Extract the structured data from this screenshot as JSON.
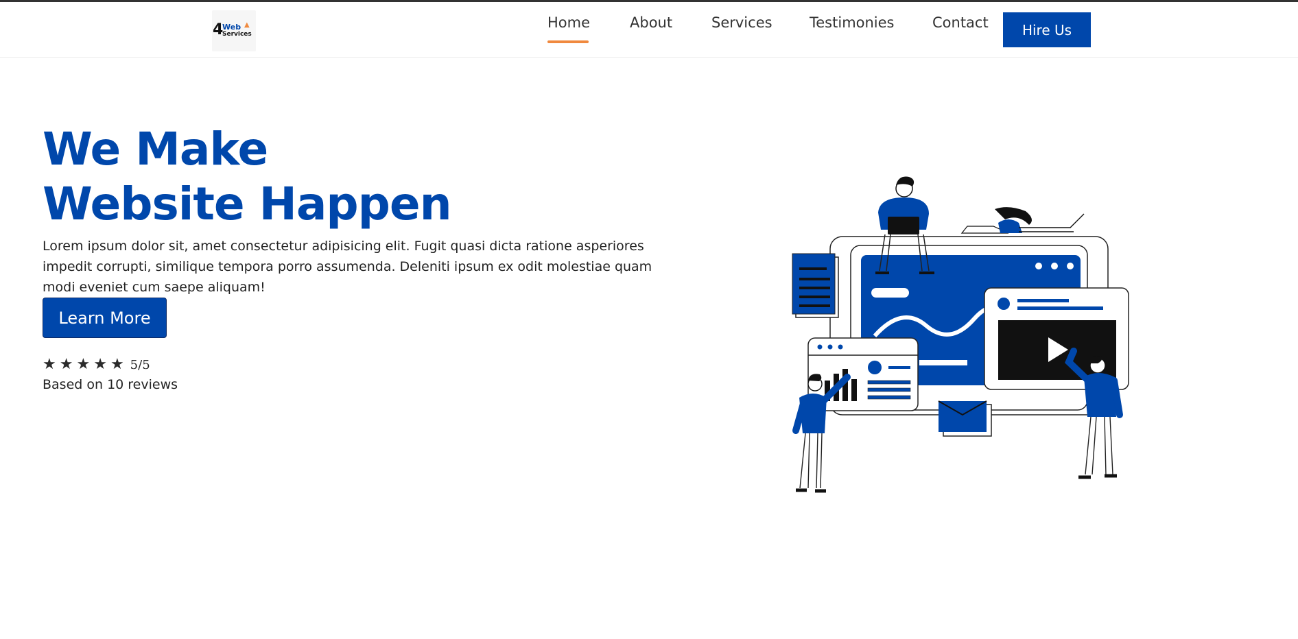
{
  "brand": {
    "logo_number": "4",
    "logo_word_top": "Web",
    "logo_word_bottom": "Services"
  },
  "nav": {
    "items": [
      {
        "label": "Home",
        "active": true
      },
      {
        "label": "About"
      },
      {
        "label": "Services"
      },
      {
        "label": "Testimonies"
      },
      {
        "label": "Contact"
      }
    ],
    "cta_label": "Hire Us"
  },
  "hero": {
    "title_line1": "We Make",
    "title_line2": "Website Happen",
    "description": "Lorem ipsum dolor sit, amet consectetur adipisicing elit. Fugit quasi dicta ratione asperiores impedit corrupti, similique tempora porro assumenda. Deleniti ipsum ex odit molestiae quam modi eveniet cum saepe aliquam!",
    "button_label": "Learn More",
    "stars": 5,
    "rating_text": "5/5",
    "reviews_text": "Based on 10 reviews"
  },
  "colors": {
    "primary": "#0047ab",
    "accent": "#f0893e",
    "text": "#222222"
  },
  "icons": [
    "star-icon",
    "play-icon",
    "envelope-icon"
  ]
}
